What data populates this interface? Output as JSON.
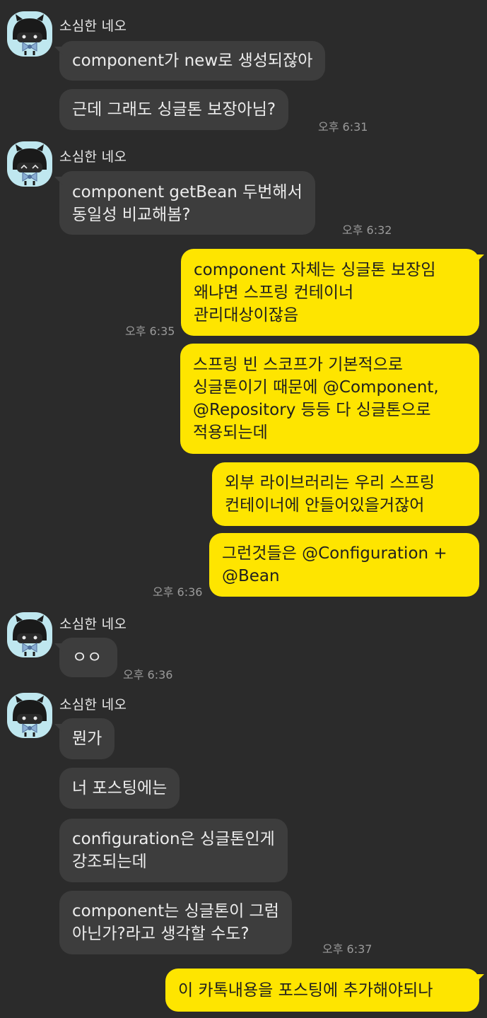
{
  "sender_name": "소심한 네오",
  "colors": {
    "background": "#2b2b2b",
    "incoming_bubble": "#3d3d3d",
    "outgoing_bubble": "#fee500",
    "avatar_bg": "#bfe7ef"
  },
  "messages": [
    {
      "side": "in",
      "text": "component가 new로 생성되잖아"
    },
    {
      "side": "in",
      "text": "근데 그래도 싱글톤 보장아님?",
      "time": "오후 6:31"
    },
    {
      "side": "in",
      "text": "component getBean 두번해서\n동일성 비교해봄?",
      "time": "오후 6:32"
    },
    {
      "side": "out",
      "text": "component 자체는 싱글톤 보장임\n왜냐면 스프링 컨테이너\n관리대상이잖음",
      "time": "오후 6:35"
    },
    {
      "side": "out",
      "text": "스프링 빈 스코프가 기본적으로\n싱글톤이기 때문에 @Component,\n@Repository 등등 다 싱글톤으로\n적용되는데"
    },
    {
      "side": "out",
      "text": "외부 라이브러리는 우리 스프링\n컨테이너에 안들어있을거잖어"
    },
    {
      "side": "out",
      "text": "그런것들은 @Configuration +\n@Bean",
      "time": "오후 6:36"
    },
    {
      "side": "in",
      "text": "ㅇㅇ",
      "time": "오후 6:36"
    },
    {
      "side": "in",
      "text": "뭔가"
    },
    {
      "side": "in",
      "text": "너 포스팅에는"
    },
    {
      "side": "in",
      "text": "configuration은 싱글톤인게\n강조되는데"
    },
    {
      "side": "in",
      "text": "component는 싱글톤이 그럼\n아닌가?라고 생각할 수도?",
      "time": "오후 6:37"
    },
    {
      "side": "out",
      "text": "이 카톡내용을 포스팅에 추가해야되나"
    }
  ]
}
